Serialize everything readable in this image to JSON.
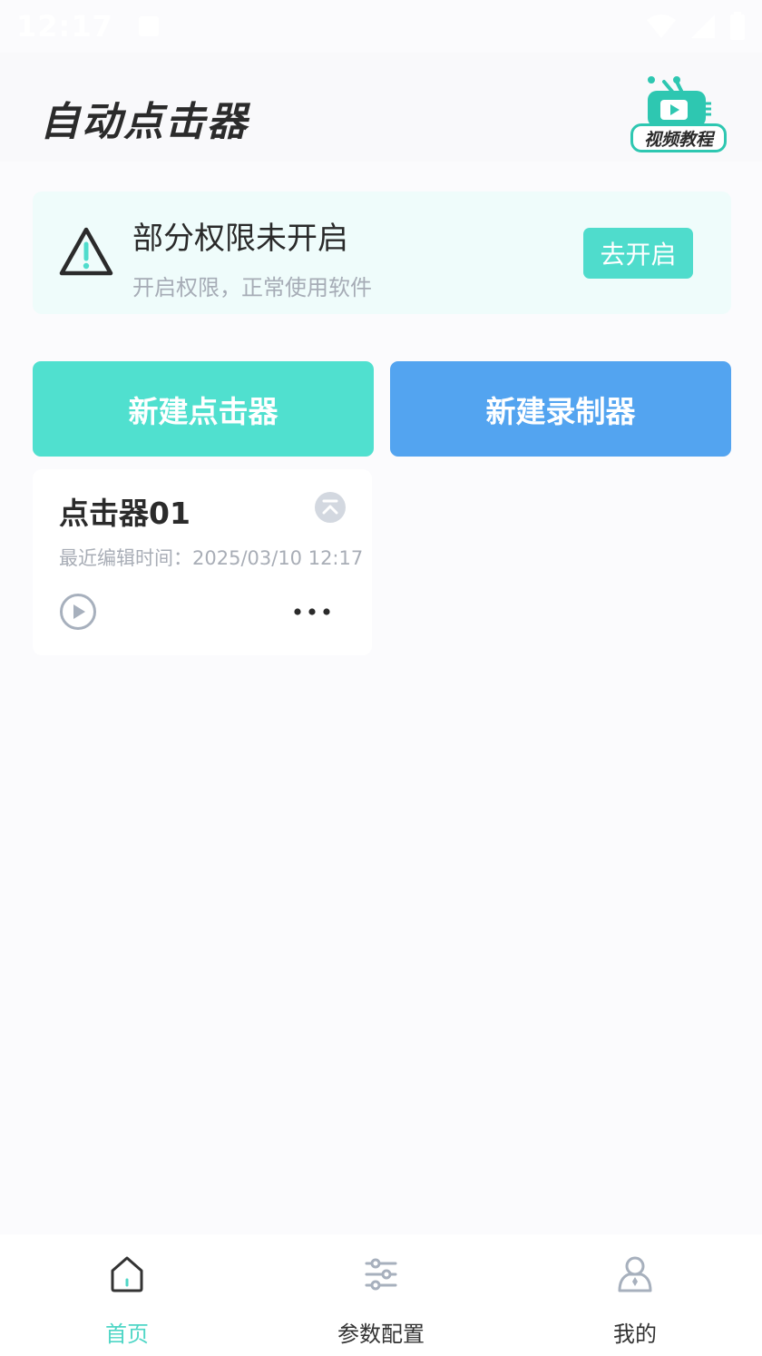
{
  "status_bar": {
    "time": "12:17"
  },
  "header": {
    "title": "自动点击器",
    "tutorial_label": "视频教程"
  },
  "permission_banner": {
    "title": "部分权限未开启",
    "subtitle": "开启权限，正常使用软件",
    "button_label": "去开启"
  },
  "actions": {
    "new_clicker": "新建点击器",
    "new_recorder": "新建录制器"
  },
  "clicker_list": [
    {
      "name": "点击器01",
      "edited": "最近编辑时间：2025/03/10 12:17"
    }
  ],
  "bottom_nav": [
    {
      "label": "首页",
      "icon": "home-icon",
      "active": true
    },
    {
      "label": "参数配置",
      "icon": "sliders-icon",
      "active": false
    },
    {
      "label": "我的",
      "icon": "profile-icon",
      "active": false
    }
  ],
  "colors": {
    "accent": "#4fdccc",
    "blue": "#53a4f0",
    "banner_bg": "#effcfb",
    "subtle_text": "#a8adb6"
  }
}
